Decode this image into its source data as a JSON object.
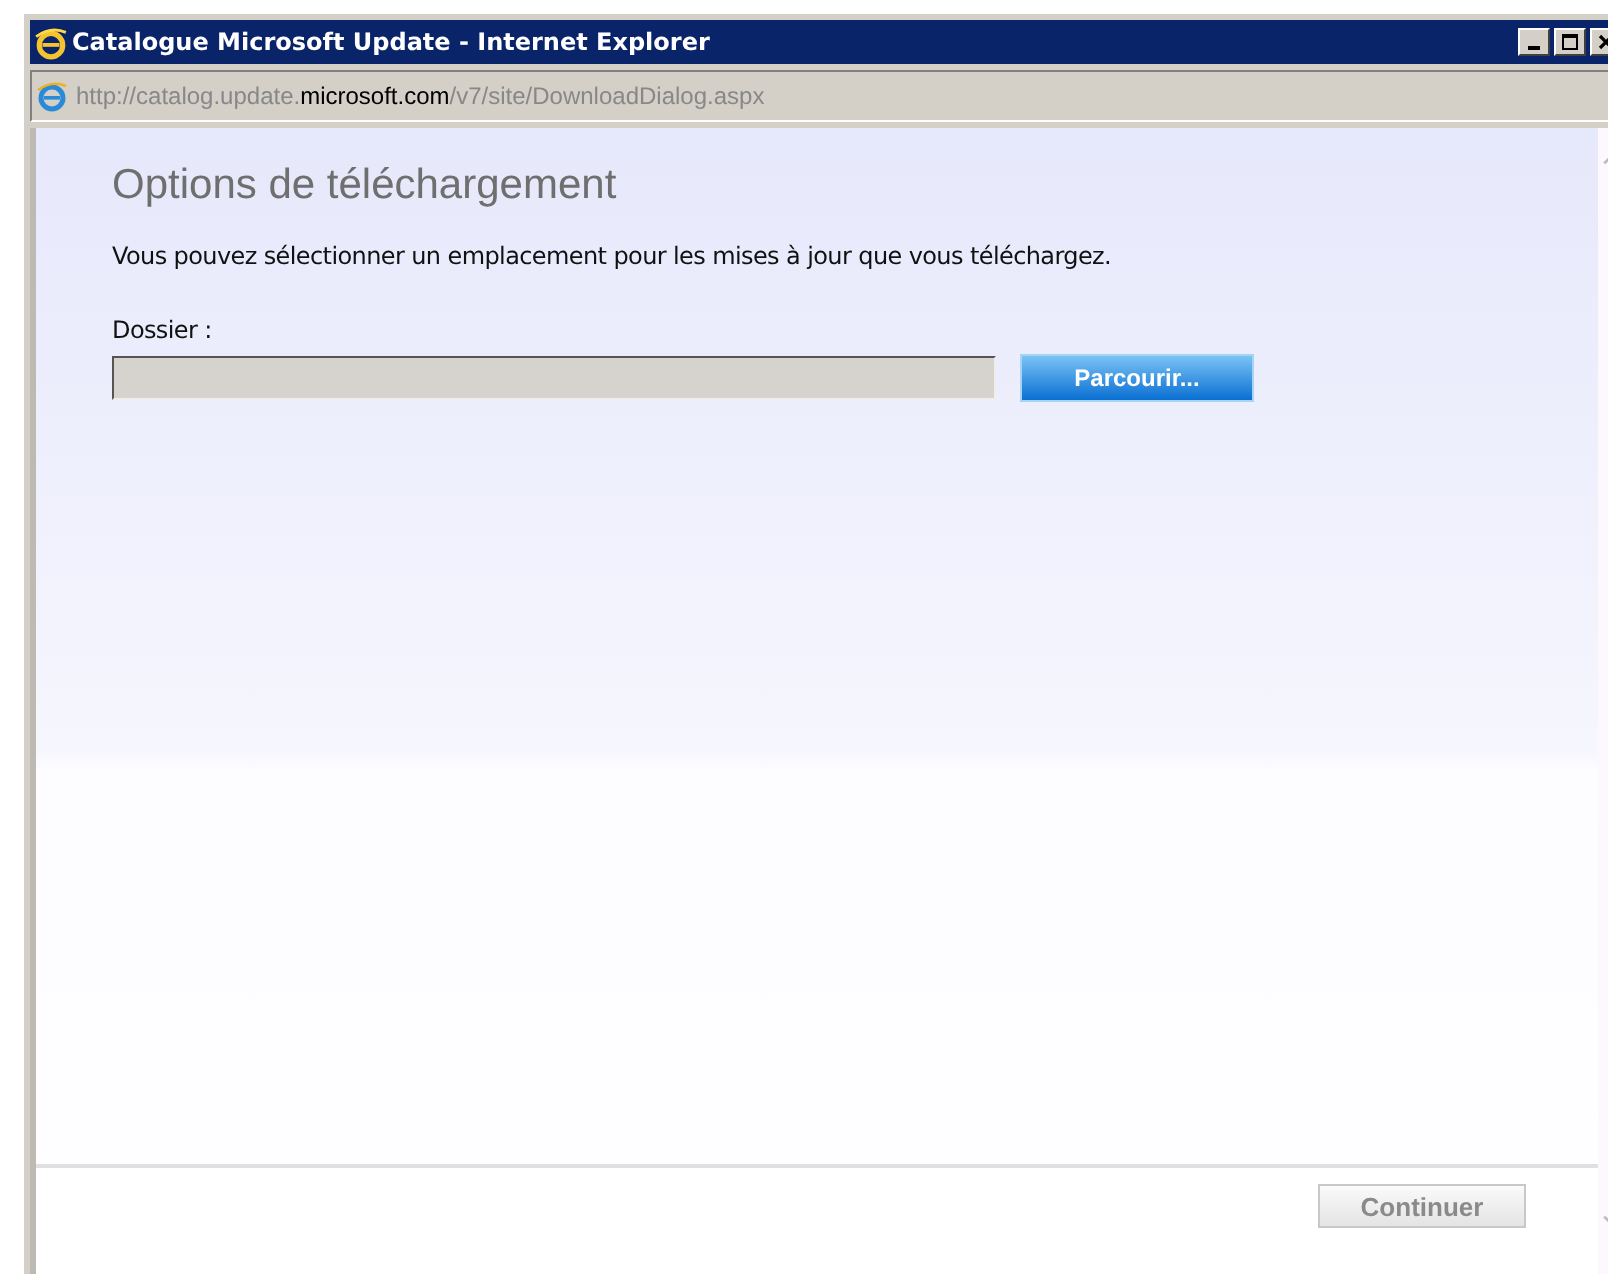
{
  "window": {
    "title": "Catalogue Microsoft Update - Internet Explorer"
  },
  "address_bar": {
    "url_start": "http://catalog.update.",
    "url_domain": "microsoft.com",
    "url_end": "/v7/site/DownloadDialog.aspx"
  },
  "dialog": {
    "heading": "Options de téléchargement",
    "description": "Vous pouvez sélectionner un emplacement pour les mises à jour que vous téléchargez.",
    "folder_label": "Dossier :",
    "browse_button": "Parcourir...",
    "continue_button": {
      "label": "Continuer",
      "disabled": true
    }
  }
}
